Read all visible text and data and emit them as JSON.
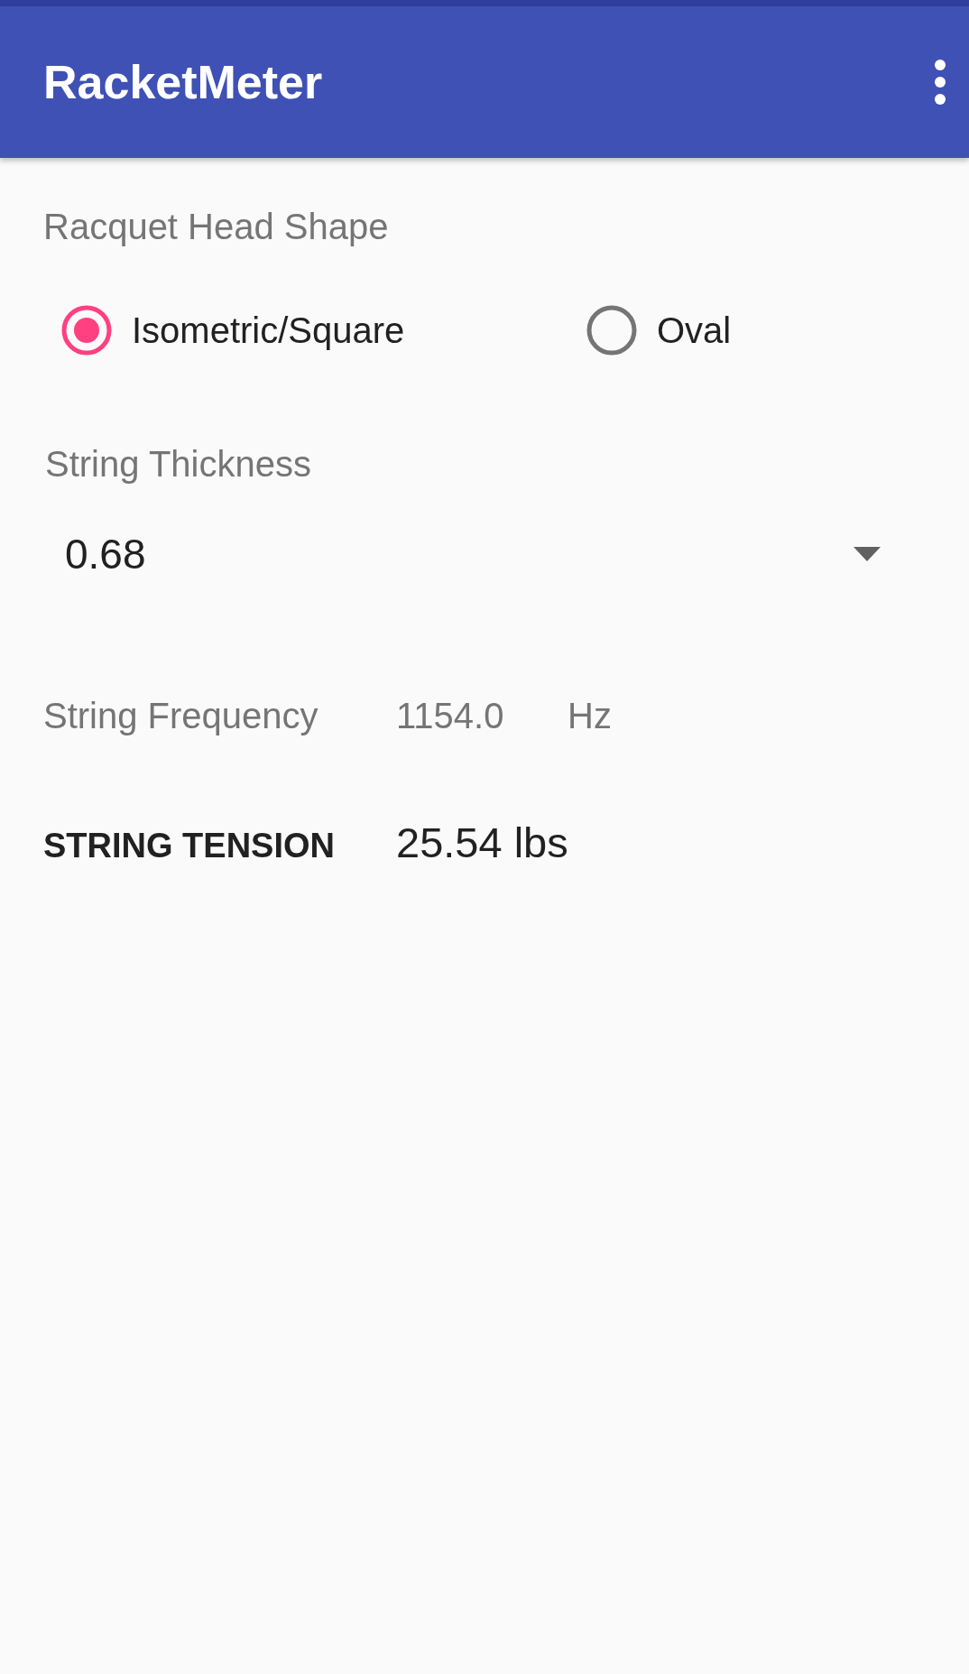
{
  "app_bar": {
    "title": "RacketMeter"
  },
  "head_shape": {
    "label": "Racquet Head Shape",
    "options": [
      {
        "label": "Isometric/Square",
        "selected": true
      },
      {
        "label": "Oval",
        "selected": false
      }
    ]
  },
  "thickness": {
    "label": "String Thickness",
    "value": "0.68"
  },
  "frequency": {
    "label": "String Frequency",
    "value": "1154.0",
    "unit": "Hz"
  },
  "tension": {
    "label": "STRING TENSION",
    "value": "25.54 lbs"
  }
}
